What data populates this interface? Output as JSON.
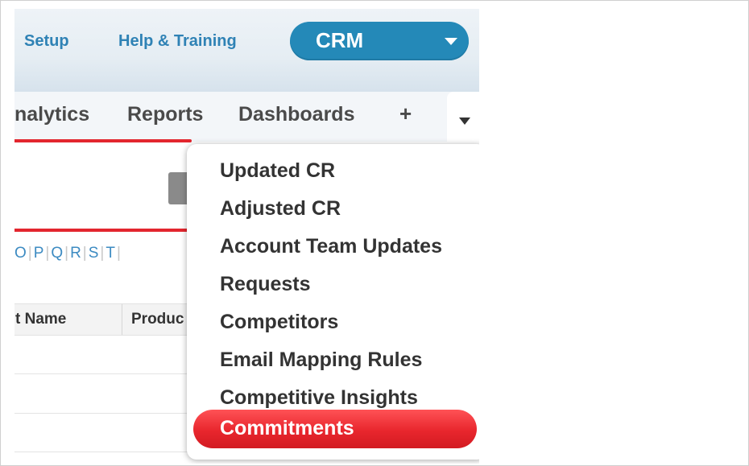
{
  "header": {
    "setup_label": "Setup",
    "help_label": "Help & Training",
    "app_switcher": {
      "label": "CRM",
      "icon": "chevron-down-icon"
    }
  },
  "tabs": {
    "items": [
      "nalytics",
      "Reports",
      "Dashboards"
    ],
    "add_icon": "+",
    "more_icon": "chevron-down-icon"
  },
  "alphabet": [
    "O",
    "P",
    "Q",
    "R",
    "S",
    "T"
  ],
  "table": {
    "headers": [
      "t Name",
      "Produc"
    ]
  },
  "menu": {
    "items": [
      "Updated CR",
      "Adjusted CR",
      "Account Team Updates",
      "Requests",
      "Competitors",
      "Email Mapping Rules",
      "Competitive Insights"
    ],
    "active_item": "Commitments"
  },
  "colors": {
    "accent_blue": "#2489b8",
    "link_blue": "#2f82b5",
    "active_red": "#e8262d"
  }
}
